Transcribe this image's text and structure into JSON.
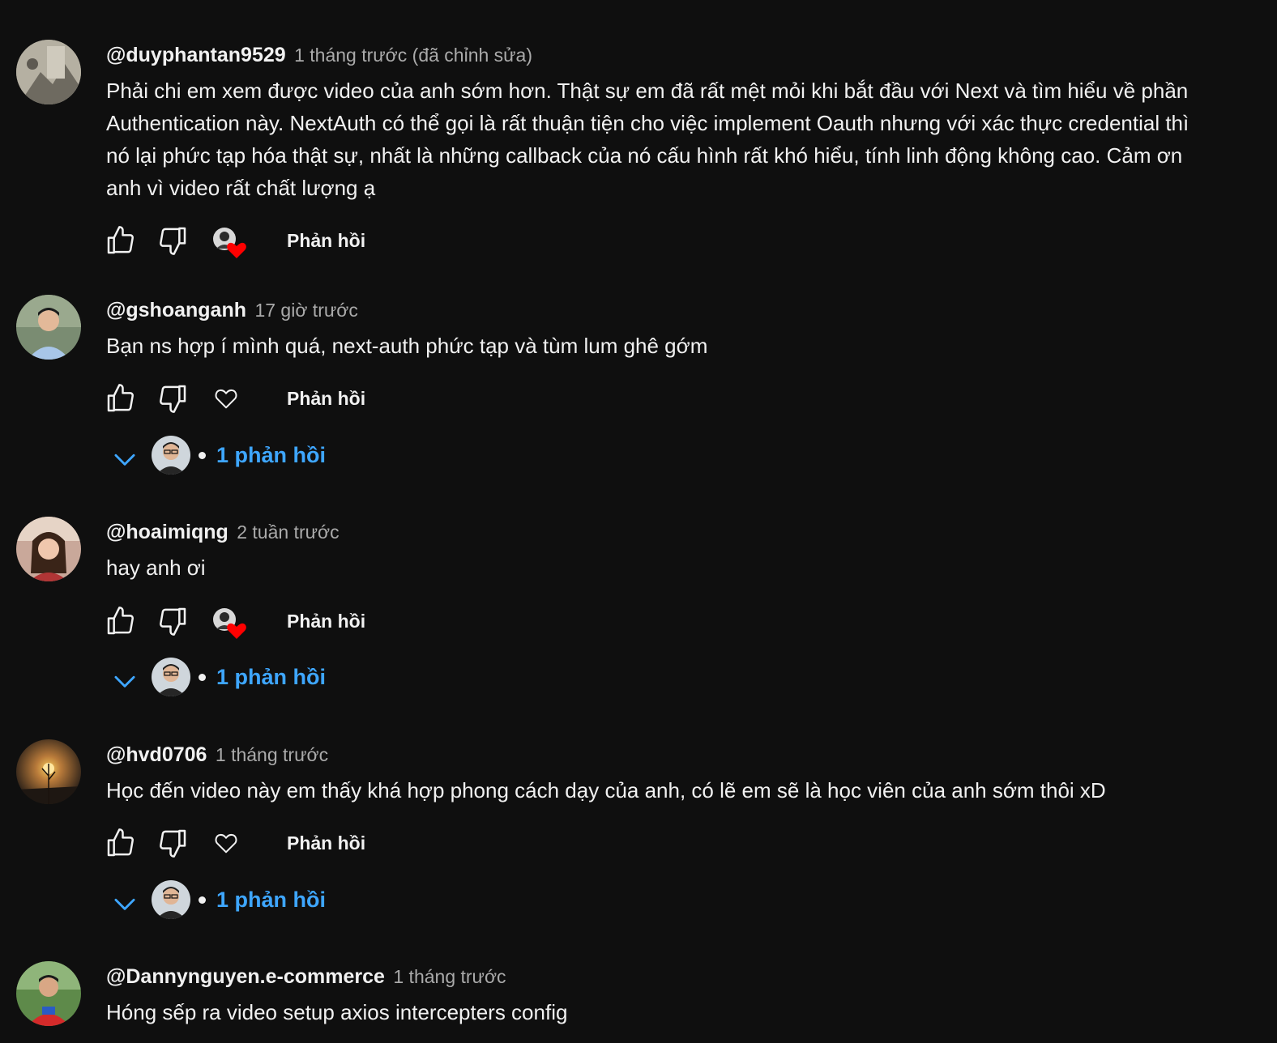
{
  "comments": [
    {
      "author": "@duyphantan9529",
      "time": "1 tháng trước (đã chỉnh sửa)",
      "text": "Phải chi em xem được video của anh sớm hơn. Thật sự em đã rất mệt mỏi khi bắt đầu với Next và tìm hiểu về phần Authentication này. NextAuth có thể gọi là rất thuận tiện cho việc implement Oauth nhưng với xác thực credential thì nó lại phức tạp hóa thật sự, nhất là những callback của nó cấu hình rất khó hiểu, tính linh động không cao. Cảm ơn anh vì video rất chất lượng ạ",
      "reply_label": "Phản hồi",
      "creator_hearted": true
    },
    {
      "author": "@gshoanganh",
      "time": "17 giờ trước",
      "text": "Bạn ns hợp í mình quá, next-auth phức tạp và tùm lum ghê gớm",
      "reply_label": "Phản hồi",
      "creator_hearted": false,
      "replies_count_label": "1 phản hồi"
    },
    {
      "author": "@hoaimiqng",
      "time": "2 tuần trước",
      "text": "hay anh ơi",
      "reply_label": "Phản hồi",
      "creator_hearted": true,
      "replies_count_label": "1 phản hồi"
    },
    {
      "author": "@hvd0706",
      "time": "1 tháng trước",
      "text": "Học đến video này em thấy khá hợp phong cách dạy của anh, có lẽ em sẽ là học viên của anh sớm thôi xD",
      "reply_label": "Phản hồi",
      "creator_hearted": false,
      "replies_count_label": "1 phản hồi"
    },
    {
      "author": "@Dannynguyen.e-commerce",
      "time": "1 tháng trước",
      "text": "Hóng sếp ra video setup axios intercepters config"
    }
  ],
  "icons": {
    "like": "thumbs-up-icon",
    "dislike": "thumbs-down-icon",
    "heart": "heart-icon",
    "expand": "chevron-down-icon"
  },
  "colors": {
    "background": "#0f0f0f",
    "text": "#f1f1f1",
    "muted": "#aaaaaa",
    "link": "#3ea6ff",
    "heart": "#ff0000"
  }
}
